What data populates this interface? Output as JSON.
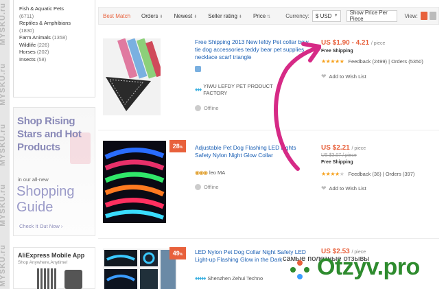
{
  "watermark": {
    "text": "MYSKU.ru"
  },
  "categories": [
    {
      "name": "Fish & Aquatic Pets",
      "count": "(6711)"
    },
    {
      "name": "Reptiles & Amphibians",
      "count": "(1830)"
    },
    {
      "name": "Farm Animals",
      "count": "(1358)"
    },
    {
      "name": "Wildlife",
      "count": "(226)"
    },
    {
      "name": "Horses",
      "count": "(202)"
    },
    {
      "name": "Insects",
      "count": "(58)"
    }
  ],
  "promo": {
    "headline_1": "Shop Rising",
    "headline_2": "Stars and Hot",
    "headline_3": "Products",
    "small": "in our all-new",
    "shopping": "Shopping",
    "guide": "Guide",
    "cta": "Check It Out Now ›"
  },
  "mobile": {
    "title": "AliExpress Mobile App",
    "subtitle": "Shop Anywhere,Anytime!"
  },
  "toolbar": {
    "best_match": "Best Match",
    "orders": "Orders",
    "newest": "Newest",
    "seller_rating": "Seller rating",
    "price": "Price",
    "currency_label": "Currency:",
    "currency_value": "$ USD",
    "show_price": "Show Price Per Piece",
    "view_label": "View:"
  },
  "products": [
    {
      "title": "Free Shipping 2013 New lefdy Pet collar bow tie dog accessories teddy bear pet supplies necklace scarf triangle",
      "seller": "YIWU LEFDY PET PRODUCT FACTORY",
      "status": "Offline",
      "price": "US $1.90 - 4.21",
      "per": "/ piece",
      "shipping": "Free Shipping",
      "feedback": "Feedback (2499)",
      "orders": "Orders (5350)",
      "wish": "Add to Wish List"
    },
    {
      "title": "Adjustable Pet Dog Flashing LED Lights Safety Nylon Night Glow Collar",
      "seller": "leo MA",
      "status": "Offline",
      "discount": "28",
      "price": "US $2.21",
      "per": "/ piece",
      "original_price": "US $3.07 / piece",
      "shipping": "Free Shipping",
      "feedback": "Feedback (36)",
      "orders": "Orders (397)",
      "wish": "Add to Wish List"
    },
    {
      "title": "LED Nylon Pet Dog Collar Night Safety LED Light-up Flashing Glow in the Dark",
      "seller": "Shenzhen Zehui Techno",
      "discount": "49",
      "price": "US $2.53",
      "per": "/ piece"
    }
  ],
  "otzyv": {
    "tagline": "самые полезные отзывы",
    "logo_text": "Otzyv.pro"
  }
}
